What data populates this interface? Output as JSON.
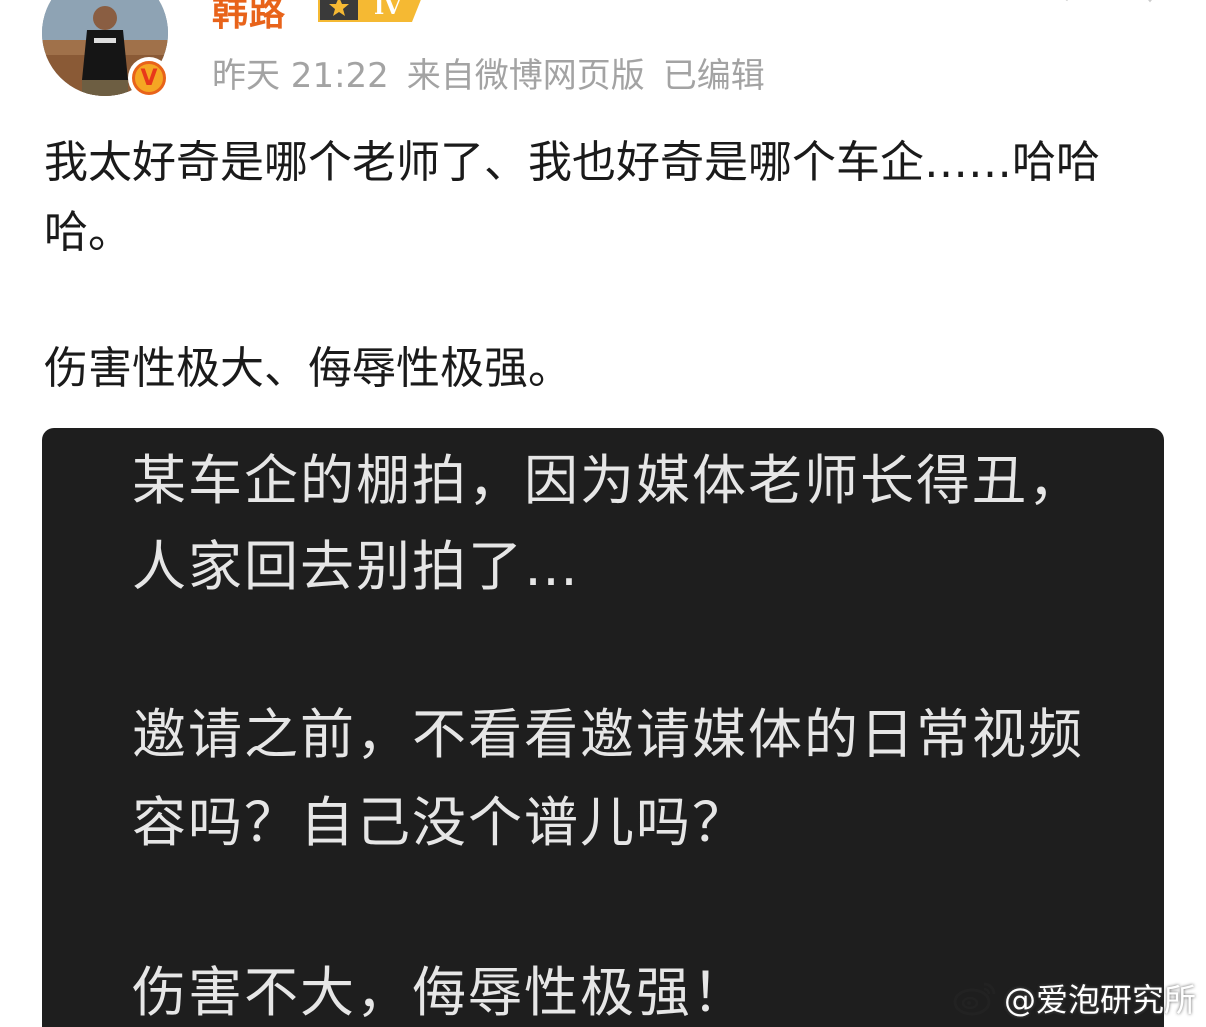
{
  "user": {
    "name": "韩路",
    "level": "IV",
    "verified": "V"
  },
  "meta": {
    "time": "昨天 21:22",
    "source": "来自微博网页版",
    "edited": "已编辑"
  },
  "post": {
    "line1": "我太好奇是哪个老师了、我也好奇是哪个车企……哈哈哈。",
    "line2": "伤害性极大、侮辱性极强。"
  },
  "embedded_image": {
    "line1": "某车企的棚拍，因为媒体老师长得丑，",
    "line2": "人家回去别拍了…",
    "line3": "邀请之前，不看看邀请媒体的日常视频",
    "line4": "容吗？自己没个谱儿吗？",
    "line5": "伤害不大，侮辱性极强！"
  },
  "watermark": {
    "text": "@爱泡研究所"
  },
  "colors": {
    "username": "#e8631a",
    "meta": "#a3a3a3",
    "text": "#1a1a1a",
    "embed_bg": "#1e1e1e",
    "embed_text": "#e6e6e6"
  }
}
